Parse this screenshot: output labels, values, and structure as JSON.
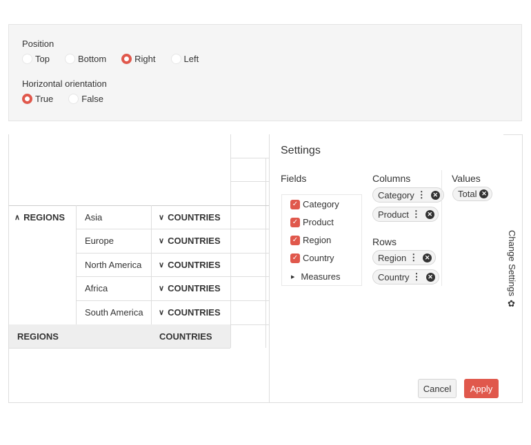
{
  "options": {
    "position_label": "Position",
    "position_options": [
      "Top",
      "Bottom",
      "Right",
      "Left"
    ],
    "position_selected": "Right",
    "orientation_label": "Horizontal orientation",
    "orientation_options": [
      "True",
      "False"
    ],
    "orientation_selected": "True"
  },
  "grid": {
    "regions_header": "REGIONS",
    "countries_header": "COUNTRIES",
    "rows": [
      "Asia",
      "Europe",
      "North America",
      "Africa",
      "South America"
    ],
    "total_regions": "REGIONS",
    "total_countries": "COUNTRIES"
  },
  "settings": {
    "title": "Settings",
    "fields_title": "Fields",
    "fields": [
      "Category",
      "Product",
      "Region",
      "Country"
    ],
    "measures": "Measures",
    "columns_title": "Columns",
    "columns": [
      "Category",
      "Product"
    ],
    "rows_title": "Rows",
    "rows": [
      "Region",
      "Country"
    ],
    "values_title": "Values",
    "values": [
      "Total"
    ],
    "cancel": "Cancel",
    "apply": "Apply"
  },
  "side": {
    "label": "Change Settings",
    "icon": "gear-icon"
  },
  "colors": {
    "accent": "#e0584c"
  }
}
